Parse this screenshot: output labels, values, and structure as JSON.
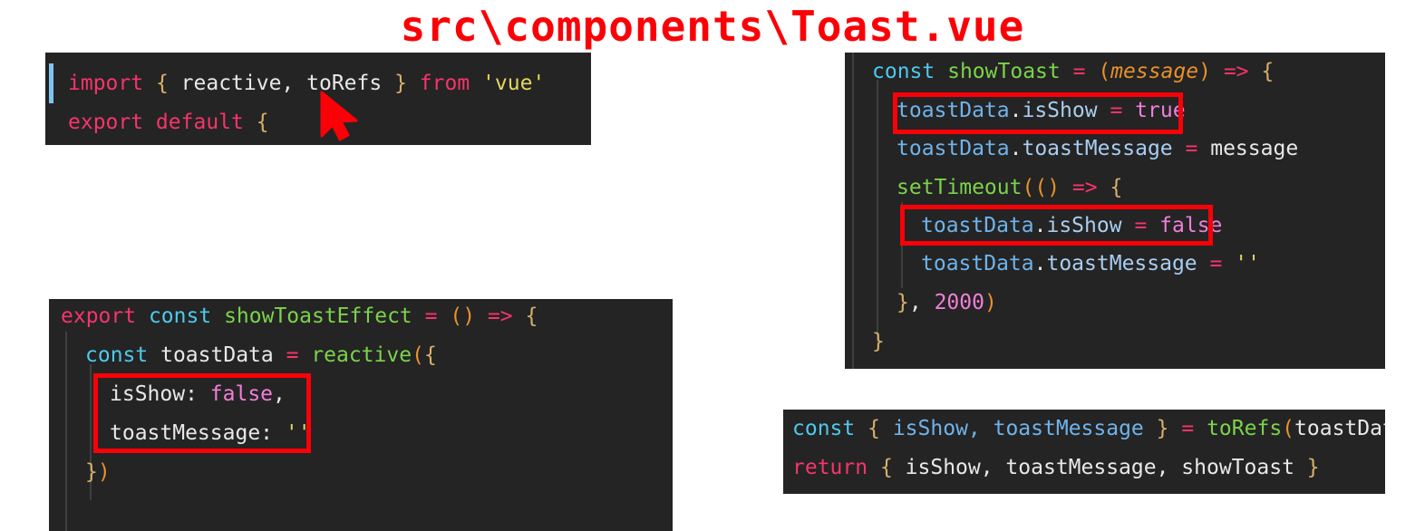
{
  "title": "src\\components\\Toast.vue",
  "theme": {
    "page_background": "#ffffff",
    "code_background": "#242424",
    "title_color": "#fb0007",
    "title_outline": "#ffffff",
    "highlight_box_color": "#fb0007",
    "cursor_color": "#fb0007",
    "keyword": "#f7346a",
    "const_keyword": "#4ec9ec",
    "function_name": "#7bd34b",
    "brace": "#d7b06a",
    "paren": "#e8912a",
    "string": "#e3d75d",
    "identifier": "#e8e8e8",
    "boolean": "#f07fd9",
    "number": "#f07fd9",
    "property": "#6fb3ec",
    "parameter": "#e8912a"
  },
  "panels": {
    "imports": {
      "name": "imports-panel",
      "lines": [
        {
          "tokens": [
            {
              "t": "import",
              "c": "kw"
            },
            {
              "t": " ",
              "c": "plain"
            },
            {
              "t": "{",
              "c": "brace"
            },
            {
              "t": " reactive, toRefs ",
              "c": "plain"
            },
            {
              "t": "}",
              "c": "brace"
            },
            {
              "t": " ",
              "c": "plain"
            },
            {
              "t": "from",
              "c": "kw"
            },
            {
              "t": " ",
              "c": "plain"
            },
            {
              "t": "'vue'",
              "c": "str"
            }
          ]
        },
        {
          "tokens": [
            {
              "t": "export default",
              "c": "kw"
            },
            {
              "t": " ",
              "c": "plain"
            },
            {
              "t": "{",
              "c": "brace"
            }
          ]
        }
      ]
    },
    "show_toast": {
      "name": "show-toast-panel",
      "lines": [
        {
          "tokens": [
            {
              "t": "const",
              "c": "kw2"
            },
            {
              "t": " ",
              "c": "plain"
            },
            {
              "t": "showToast",
              "c": "fn"
            },
            {
              "t": " ",
              "c": "plain"
            },
            {
              "t": "=",
              "c": "op"
            },
            {
              "t": " ",
              "c": "plain"
            },
            {
              "t": "(",
              "c": "paren"
            },
            {
              "t": "message",
              "c": "param"
            },
            {
              "t": ")",
              "c": "paren"
            },
            {
              "t": " ",
              "c": "plain"
            },
            {
              "t": "=>",
              "c": "op"
            },
            {
              "t": " ",
              "c": "plain"
            },
            {
              "t": "{",
              "c": "brace"
            }
          ]
        },
        {
          "tokens": [
            {
              "t": "toastData",
              "c": "prop"
            },
            {
              "t": ".",
              "c": "dot"
            },
            {
              "t": "isShow",
              "c": "prop2"
            },
            {
              "t": " ",
              "c": "plain"
            },
            {
              "t": "=",
              "c": "op"
            },
            {
              "t": " ",
              "c": "plain"
            },
            {
              "t": "true",
              "c": "bool"
            }
          ]
        },
        {
          "tokens": [
            {
              "t": "toastData",
              "c": "prop"
            },
            {
              "t": ".",
              "c": "dot"
            },
            {
              "t": "toastMessage",
              "c": "prop2"
            },
            {
              "t": " ",
              "c": "plain"
            },
            {
              "t": "=",
              "c": "op"
            },
            {
              "t": " ",
              "c": "plain"
            },
            {
              "t": "message",
              "c": "plain"
            }
          ]
        },
        {
          "tokens": [
            {
              "t": "setTimeout",
              "c": "fn"
            },
            {
              "t": "((",
              "c": "paren"
            },
            {
              "t": ")",
              "c": "paren"
            },
            {
              "t": " ",
              "c": "plain"
            },
            {
              "t": "=>",
              "c": "op"
            },
            {
              "t": " ",
              "c": "plain"
            },
            {
              "t": "{",
              "c": "brace"
            }
          ]
        },
        {
          "tokens": [
            {
              "t": "toastData",
              "c": "prop"
            },
            {
              "t": ".",
              "c": "dot"
            },
            {
              "t": "isShow",
              "c": "prop2"
            },
            {
              "t": " ",
              "c": "plain"
            },
            {
              "t": "=",
              "c": "op"
            },
            {
              "t": " ",
              "c": "plain"
            },
            {
              "t": "false",
              "c": "bool"
            }
          ]
        },
        {
          "tokens": [
            {
              "t": "toastData",
              "c": "prop"
            },
            {
              "t": ".",
              "c": "dot"
            },
            {
              "t": "toastMessage",
              "c": "prop2"
            },
            {
              "t": " ",
              "c": "plain"
            },
            {
              "t": "=",
              "c": "op"
            },
            {
              "t": " ",
              "c": "plain"
            },
            {
              "t": "''",
              "c": "str"
            }
          ]
        },
        {
          "tokens": [
            {
              "t": "}",
              "c": "brace"
            },
            {
              "t": ", ",
              "c": "plain"
            },
            {
              "t": "2000",
              "c": "num"
            },
            {
              "t": ")",
              "c": "paren"
            }
          ]
        },
        {
          "tokens": [
            {
              "t": "}",
              "c": "brace"
            }
          ]
        }
      ]
    },
    "show_toast_effect": {
      "name": "show-toast-effect-panel",
      "lines": [
        {
          "tokens": [
            {
              "t": "export",
              "c": "kw"
            },
            {
              "t": " ",
              "c": "plain"
            },
            {
              "t": "const",
              "c": "kw2"
            },
            {
              "t": " ",
              "c": "plain"
            },
            {
              "t": "showToastEffect",
              "c": "fn"
            },
            {
              "t": " ",
              "c": "plain"
            },
            {
              "t": "=",
              "c": "op"
            },
            {
              "t": " ",
              "c": "plain"
            },
            {
              "t": "()",
              "c": "paren"
            },
            {
              "t": " ",
              "c": "plain"
            },
            {
              "t": "=>",
              "c": "op"
            },
            {
              "t": " ",
              "c": "plain"
            },
            {
              "t": "{",
              "c": "brace"
            }
          ]
        },
        {
          "tokens": [
            {
              "t": "const",
              "c": "kw2"
            },
            {
              "t": " ",
              "c": "plain"
            },
            {
              "t": "toastData",
              "c": "plain"
            },
            {
              "t": " ",
              "c": "plain"
            },
            {
              "t": "=",
              "c": "op"
            },
            {
              "t": " ",
              "c": "plain"
            },
            {
              "t": "reactive",
              "c": "fn"
            },
            {
              "t": "(",
              "c": "paren"
            },
            {
              "t": "{",
              "c": "brace"
            }
          ]
        },
        {
          "tokens": [
            {
              "t": "isShow: ",
              "c": "plain"
            },
            {
              "t": "false",
              "c": "bool"
            },
            {
              "t": ",",
              "c": "plain"
            }
          ]
        },
        {
          "tokens": [
            {
              "t": "toastMessage: ",
              "c": "plain"
            },
            {
              "t": "''",
              "c": "str"
            }
          ]
        },
        {
          "tokens": [
            {
              "t": "}",
              "c": "brace"
            },
            {
              "t": ")",
              "c": "paren"
            }
          ]
        }
      ]
    },
    "to_refs": {
      "name": "to-refs-panel",
      "lines": [
        {
          "tokens": [
            {
              "t": "const",
              "c": "kw2"
            },
            {
              "t": " ",
              "c": "plain"
            },
            {
              "t": "{",
              "c": "brace"
            },
            {
              "t": " ",
              "c": "plain"
            },
            {
              "t": "isShow, toastMessage",
              "c": "prop"
            },
            {
              "t": " ",
              "c": "plain"
            },
            {
              "t": "}",
              "c": "brace"
            },
            {
              "t": " ",
              "c": "plain"
            },
            {
              "t": "=",
              "c": "op"
            },
            {
              "t": " ",
              "c": "plain"
            },
            {
              "t": "toRefs",
              "c": "fn"
            },
            {
              "t": "(",
              "c": "paren"
            },
            {
              "t": "toastData",
              "c": "plain"
            },
            {
              "t": ")",
              "c": "paren"
            }
          ]
        },
        {
          "tokens": [
            {
              "t": "return",
              "c": "kw"
            },
            {
              "t": " ",
              "c": "plain"
            },
            {
              "t": "{",
              "c": "brace"
            },
            {
              "t": " isShow, toastMessage, showToast ",
              "c": "plain"
            },
            {
              "t": "}",
              "c": "brace"
            }
          ]
        }
      ]
    }
  },
  "annotations": {
    "highlight_boxes": [
      {
        "name": "highlight-isshow-true",
        "label": "toastData.isShow = true"
      },
      {
        "name": "highlight-isshow-false",
        "label": "toastData.isShow = false"
      },
      {
        "name": "highlight-reactive-object",
        "label": "isShow: false, toastMessage: ''"
      }
    ],
    "cursor": {
      "name": "mouse-cursor",
      "shape": "arrow-pointer"
    }
  }
}
